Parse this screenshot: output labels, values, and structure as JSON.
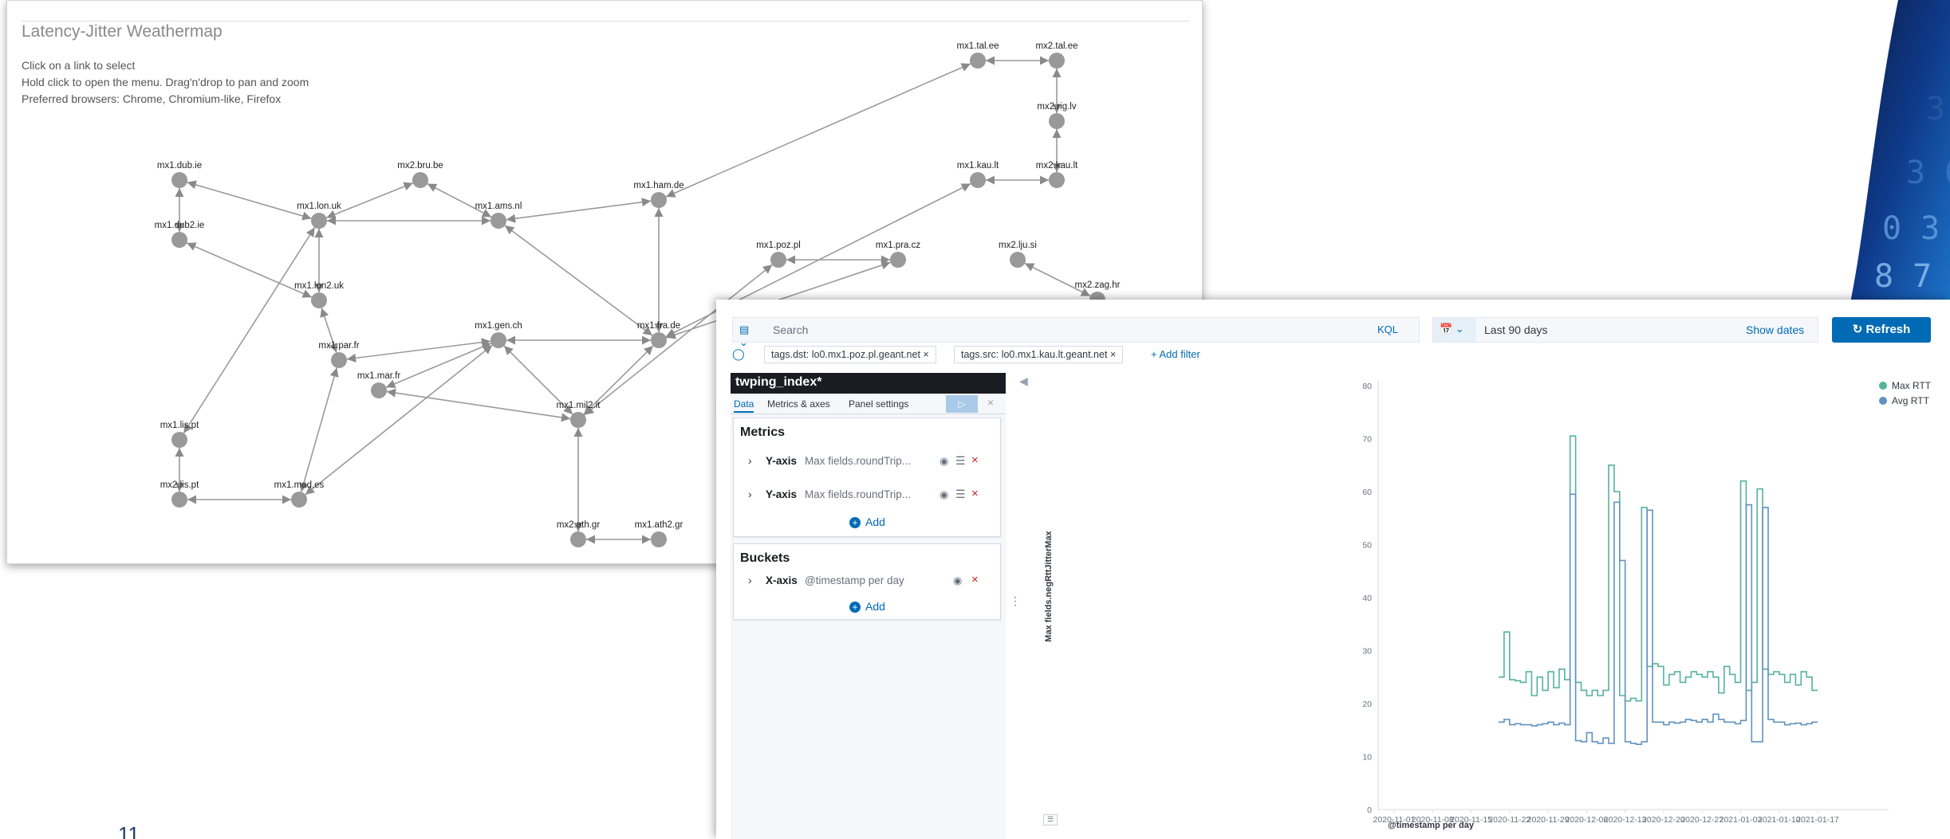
{
  "slide": {
    "page_number": "11"
  },
  "weathermap": {
    "title": "Latency-Jitter Weathermap",
    "instructions": [
      "Click on a link to select",
      "Hold click to open the menu. Drag'n'drop to pan and zoom",
      "Preferred browsers: Chrome, Chromium-like, Firefox"
    ],
    "nodes": [
      {
        "id": "mx1.dub.ie",
        "label": "mx1.dub.ie"
      },
      {
        "id": "mx1.dub2.ie",
        "label": "mx1.dub2.ie"
      },
      {
        "id": "mx1.lon.uk",
        "label": "mx1.lon.uk"
      },
      {
        "id": "mx2.bru.be",
        "label": "mx2.bru.be"
      },
      {
        "id": "mx1.ams.nl",
        "label": "mx1.ams.nl"
      },
      {
        "id": "mx1.ham.de",
        "label": "mx1.ham.de"
      },
      {
        "id": "mx1.tal.ee",
        "label": "mx1.tal.ee"
      },
      {
        "id": "mx2.tal.ee",
        "label": "mx2.tal.ee"
      },
      {
        "id": "mx2.rig.lv",
        "label": "mx2.rig.lv"
      },
      {
        "id": "mx1.kau.lt",
        "label": "mx1.kau.lt"
      },
      {
        "id": "mx2.kau.lt",
        "label": "mx2.kau.lt"
      },
      {
        "id": "mx1.lon2.uk",
        "label": "mx1.lon2.uk"
      },
      {
        "id": "mx1.par.fr",
        "label": "mx1.par.fr"
      },
      {
        "id": "mx1.gen.ch",
        "label": "mx1.gen.ch"
      },
      {
        "id": "mx1.fra.de",
        "label": "mx1.fra.de"
      },
      {
        "id": "mx1.poz.pl",
        "label": "mx1.poz.pl"
      },
      {
        "id": "mx1.pra.cz",
        "label": "mx1.pra.cz"
      },
      {
        "id": "mx2.lju.si",
        "label": "mx2.lju.si"
      },
      {
        "id": "mx2.zag.hr",
        "label": "mx2.zag.hr"
      },
      {
        "id": "mx1.mar.fr",
        "label": "mx1.mar.fr"
      },
      {
        "id": "mx1.mil2.it",
        "label": "mx1.mil2.it"
      },
      {
        "id": "mx1.lis.pt",
        "label": "mx1.lis.pt"
      },
      {
        "id": "mx2.lis.pt",
        "label": "mx2.lis.pt"
      },
      {
        "id": "mx1.mad.es",
        "label": "mx1.mad.es"
      },
      {
        "id": "mx2.ath.gr",
        "label": "mx2.ath.gr"
      },
      {
        "id": "mx1.ath2.gr",
        "label": "mx1.ath2.gr"
      }
    ],
    "links": [
      [
        "mx1.lon.uk",
        "mx1.dub.ie"
      ],
      [
        "mx1.dub.ie",
        "mx1.dub2.ie"
      ],
      [
        "mx1.lon2.uk",
        "mx1.dub2.ie"
      ],
      [
        "mx1.lon.uk",
        "mx2.bru.be"
      ],
      [
        "mx2.bru.be",
        "mx1.ams.nl"
      ],
      [
        "mx1.ams.nl",
        "mx1.lon.uk"
      ],
      [
        "mx1.lon2.uk",
        "mx1.lon.uk"
      ],
      [
        "mx1.ham.de",
        "mx1.ams.nl"
      ],
      [
        "mx1.ham.de",
        "mx1.tal.ee"
      ],
      [
        "mx1.tal.ee",
        "mx2.tal.ee"
      ],
      [
        "mx2.rig.lv",
        "mx2.tal.ee"
      ],
      [
        "mx2.kau.lt",
        "mx2.rig.lv"
      ],
      [
        "mx1.kau.lt",
        "mx2.kau.lt"
      ],
      [
        "mx1.fra.de",
        "mx1.ham.de"
      ],
      [
        "mx1.fra.de",
        "mx1.ams.nl"
      ],
      [
        "mx1.fra.de",
        "mx1.gen.ch"
      ],
      [
        "mx1.fra.de",
        "mx1.kau.lt"
      ],
      [
        "mx1.fra.de",
        "mx1.pra.cz"
      ],
      [
        "mx1.poz.pl",
        "mx1.mil2.it"
      ],
      [
        "mx1.gen.ch",
        "mx1.par.fr"
      ],
      [
        "mx1.par.fr",
        "mx1.lon2.uk"
      ],
      [
        "mx1.gen.ch",
        "mx1.mar.fr"
      ],
      [
        "mx1.mil2.it",
        "mx1.gen.ch"
      ],
      [
        "mx1.mil2.it",
        "mx1.mar.fr"
      ],
      [
        "mx1.mil2.it",
        "mx1.fra.de"
      ],
      [
        "mx1.lis.pt",
        "mx1.lon.uk"
      ],
      [
        "mx2.lis.pt",
        "mx1.lis.pt"
      ],
      [
        "mx2.lis.pt",
        "mx1.mad.es"
      ],
      [
        "mx1.mad.es",
        "mx1.par.fr"
      ],
      [
        "mx1.mad.es",
        "mx1.gen.ch"
      ],
      [
        "mx2.ath.gr",
        "mx1.mil2.it"
      ],
      [
        "mx2.ath.gr",
        "mx1.ath2.gr"
      ],
      [
        "mx1.pra.cz",
        "mx1.poz.pl"
      ],
      [
        "mx2.lju.si",
        "mx2.zag.hr"
      ]
    ]
  },
  "kibana": {
    "query_icon": "saved-query-icon",
    "search_placeholder": "Search",
    "kql_label": "KQL",
    "date_range": "Last 90 days",
    "show_dates": "Show dates",
    "refresh_label": "Refresh",
    "filters": [
      "tags.dst: lo0.mx1.poz.pl.geant.net",
      "tags.src: lo0.mx1.kau.lt.geant.net"
    ],
    "add_filter": "+ Add filter",
    "index_pattern": "twping_index*",
    "editor_tabs": [
      "Data",
      "Metrics & axes",
      "Panel settings"
    ],
    "metrics_title": "Metrics",
    "metrics": [
      {
        "axis": "Y-axis",
        "desc": "Max fields.roundTrip..."
      },
      {
        "axis": "Y-axis",
        "desc": "Max fields.roundTrip..."
      }
    ],
    "add_label": "Add",
    "buckets_title": "Buckets",
    "buckets": [
      {
        "axis": "X-axis",
        "desc": "@timestamp per day"
      }
    ]
  },
  "chart_data": {
    "type": "line",
    "step": true,
    "xlabel": "@timestamp per day",
    "ylabel": "Max fields.negRttJitterMax",
    "ylim": [
      0,
      80
    ],
    "y_ticks": [
      0,
      10,
      20,
      30,
      40,
      50,
      60,
      70,
      80
    ],
    "x_ticks": [
      "2020-11-01",
      "2020-11-08",
      "2020-11-15",
      "2020-11-22",
      "2020-11-29",
      "2020-12-06",
      "2020-12-13",
      "2020-12-20",
      "2020-12-27",
      "2021-01-03",
      "2021-01-10",
      "2021-01-17"
    ],
    "legend_position": "top-right",
    "x_start": "2020-11-20",
    "series": [
      {
        "name": "Max RTT",
        "color": "#54b399",
        "values": [
          25,
          33.5,
          24.5,
          24.3,
          24,
          26,
          21.5,
          25,
          22.5,
          26,
          23,
          26.5,
          24.5,
          70.5,
          24,
          22.5,
          21.5,
          22.5,
          21.5,
          22.5,
          65,
          60,
          21.5,
          20.5,
          21,
          20.5,
          57,
          27,
          27.5,
          27,
          23.5,
          25.5,
          26,
          24,
          25,
          26,
          25.5,
          25,
          26,
          25,
          22,
          27,
          25.5,
          24,
          62,
          22.5,
          24,
          60.5,
          26.5,
          25.5,
          26,
          25.5,
          24,
          25.5,
          23.5,
          26,
          25,
          22.5
        ]
      },
      {
        "name": "Avg RTT",
        "color": "#6092c0",
        "values": [
          16.5,
          17,
          16,
          16.2,
          16,
          16,
          15.8,
          16,
          16.2,
          16.5,
          16,
          16.3,
          16,
          59.5,
          13,
          12.8,
          14.5,
          12.8,
          12.5,
          13.5,
          12.5,
          58,
          47,
          12.8,
          12.5,
          12.3,
          12.8,
          56.5,
          16.5,
          16.5,
          16,
          16.5,
          16.3,
          16.5,
          17,
          16.8,
          16.5,
          17,
          16.5,
          18,
          17,
          16.5,
          16.5,
          16.2,
          16.8,
          57.5,
          12.8,
          12.8,
          57,
          17,
          16.5,
          16.5,
          16,
          16.2,
          16.3,
          16,
          16.2,
          16.5
        ]
      }
    ]
  }
}
